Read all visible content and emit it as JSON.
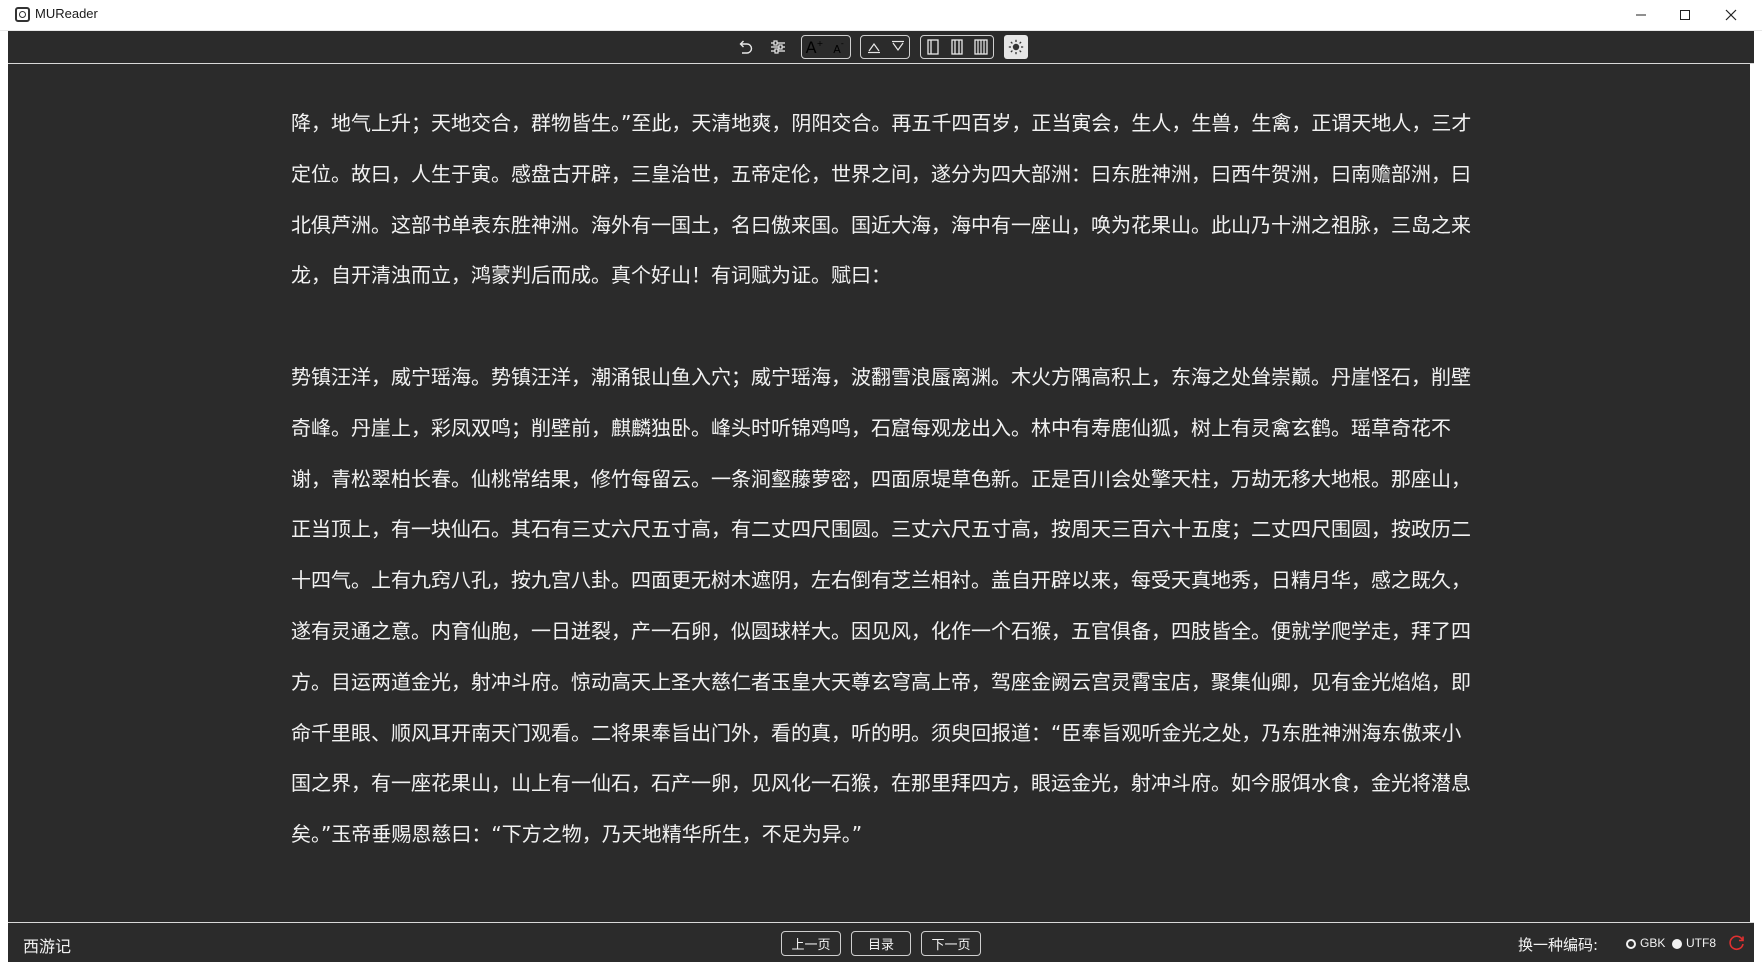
{
  "window": {
    "title": "MUReader"
  },
  "toolbar": {
    "undo_icon": "undo-icon",
    "settings_icon": "sliders-icon",
    "font_increase": "A",
    "font_decrease": "A",
    "view_mode_icons": [
      "single-column-icon",
      "double-column-icon",
      "triple-column-icon"
    ],
    "theme_icon": "brightness-icon"
  },
  "content": {
    "paragraphs": [
      "降，地气上升；天地交合，群物皆生。”至此，天清地爽，阴阳交合。再五千四百岁，正当寅会，生人，生兽，生禽，正谓天地人，三才定位。故曰，人生于寅。感盘古开辟，三皇治世，五帝定伦，世界之间，遂分为四大部洲：曰东胜神洲，曰西牛贺洲，曰南赡部洲，曰北俱芦洲。这部书单表东胜神洲。海外有一国土，名曰傲来国。国近大海，海中有一座山，唤为花果山。此山乃十洲之祖脉，三岛之来龙，自开清浊而立，鸿蒙判后而成。真个好山！有词赋为证。赋曰：",
      "势镇汪洋，威宁瑶海。势镇汪洋，潮涌银山鱼入穴；威宁瑶海，波翻雪浪蜃离渊。木火方隅高积上，东海之处耸崇巅。丹崖怪石，削壁奇峰。丹崖上，彩凤双鸣；削壁前，麒麟独卧。峰头时听锦鸡鸣，石窟每观龙出入。林中有寿鹿仙狐，树上有灵禽玄鹤。瑶草奇花不谢，青松翠柏长春。仙桃常结果，修竹每留云。一条涧壑藤萝密，四面原堤草色新。正是百川会处擎天柱，万劫无移大地根。那座山，正当顶上，有一块仙石。其石有三丈六尺五寸高，有二丈四尺围圆。三丈六尺五寸高，按周天三百六十五度；二丈四尺围圆，按政历二十四气。上有九窍八孔，按九宫八卦。四面更无树木遮阴，左右倒有芝兰相衬。盖自开辟以来，每受天真地秀，日精月华，感之既久，遂有灵通之意。内育仙胞，一日迸裂，产一石卵，似圆球样大。因见风，化作一个石猴，五官俱备，四肢皆全。便就学爬学走，拜了四方。目运两道金光，射冲斗府。惊动高天上圣大慈仁者玉皇大天尊玄穹高上帝，驾座金阙云宫灵霄宝店，聚集仙卿，见有金光焰焰，即命千里眼、顺风耳开南天门观看。二将果奉旨出门外，看的真，听的明。须臾回报道：“臣奉旨观听金光之处，乃东胜神洲海东傲来小国之界，有一座花果山，山上有一仙石，石产一卵，见风化一石猴，在那里拜四方，眼运金光，射冲斗府。如今服饵水食，金光将潜息矣。”玉帝垂赐恩慈曰：“下方之物，乃天地精华所生，不足为异。”"
    ]
  },
  "bottom": {
    "book_title": "西游记",
    "prev_label": "上一页",
    "toc_label": "目录",
    "next_label": "下一页",
    "encoding_label": "换一种编码:",
    "encoding_options": [
      "GBK",
      "UTF8"
    ],
    "encoding_selected": "UTF8"
  },
  "colors": {
    "background": "#2b2b2b",
    "text": "#f2f2f2",
    "border": "#cfcfcf",
    "refresh_accent": "#e03030"
  }
}
